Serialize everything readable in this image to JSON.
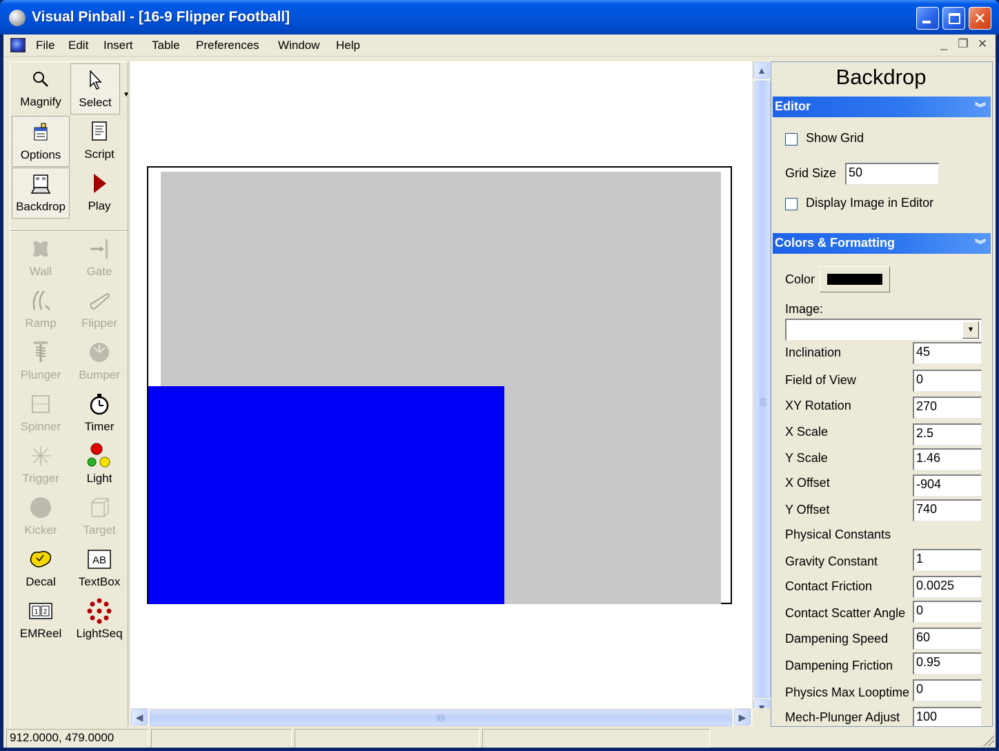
{
  "window": {
    "title": "Visual Pinball - [16-9 Flipper Football]"
  },
  "menubar": {
    "items": [
      "File",
      "Edit",
      "Insert",
      "Table",
      "Preferences",
      "Window",
      "Help"
    ],
    "mdi_min": "_",
    "mdi_restore": "❐",
    "mdi_close": "✕"
  },
  "toolbox": {
    "tools": [
      {
        "label": "Magnify",
        "icon": "magnify-icon",
        "enabled": true
      },
      {
        "label": "Select",
        "icon": "cursor-arrow-icon",
        "enabled": true,
        "pressed": true
      },
      {
        "label": "Options",
        "icon": "options-icon",
        "enabled": true,
        "pressed": true
      },
      {
        "label": "Script",
        "icon": "script-icon",
        "enabled": true
      },
      {
        "label": "Backdrop",
        "icon": "backdrop-icon",
        "enabled": true,
        "pressed": true
      },
      {
        "label": "Play",
        "icon": "play-icon",
        "enabled": true
      },
      {
        "label": "Wall",
        "icon": "wall-icon",
        "enabled": false
      },
      {
        "label": "Gate",
        "icon": "gate-icon",
        "enabled": false
      },
      {
        "label": "Ramp",
        "icon": "ramp-icon",
        "enabled": false
      },
      {
        "label": "Flipper",
        "icon": "flipper-icon",
        "enabled": false
      },
      {
        "label": "Plunger",
        "icon": "plunger-icon",
        "enabled": false
      },
      {
        "label": "Bumper",
        "icon": "bumper-icon",
        "enabled": false
      },
      {
        "label": "Spinner",
        "icon": "spinner-icon",
        "enabled": false
      },
      {
        "label": "Timer",
        "icon": "stopwatch-icon",
        "enabled": true
      },
      {
        "label": "Trigger",
        "icon": "trigger-icon",
        "enabled": false
      },
      {
        "label": "Light",
        "icon": "light-icon",
        "enabled": true
      },
      {
        "label": "Kicker",
        "icon": "kicker-icon",
        "enabled": false
      },
      {
        "label": "Target",
        "icon": "target-icon",
        "enabled": false
      },
      {
        "label": "Decal",
        "icon": "decal-icon",
        "enabled": true
      },
      {
        "label": "TextBox",
        "icon": "textbox-icon",
        "enabled": true
      },
      {
        "label": "EMReel",
        "icon": "emreel-icon",
        "enabled": true
      },
      {
        "label": "LightSeq",
        "icon": "lightseq-icon",
        "enabled": true
      }
    ]
  },
  "canvas": {
    "table_gray_color": "#c8c8c8",
    "table_blue_color": "#0000f6"
  },
  "properties": {
    "title": "Backdrop",
    "editor_header": "Editor",
    "show_grid_label": "Show Grid",
    "show_grid_checked": false,
    "grid_size_label": "Grid Size",
    "grid_size_value": "50",
    "display_image_label": "Display Image in Editor",
    "display_image_checked": false,
    "colors_header": "Colors & Formatting",
    "color_label": "Color",
    "color_value": "#000000",
    "image_label": "Image:",
    "image_value": "",
    "fields": [
      {
        "label": "Inclination",
        "value": "45"
      },
      {
        "label": "Field of View",
        "value": "0"
      },
      {
        "label": "XY Rotation",
        "value": "270"
      },
      {
        "label": "X Scale",
        "value": "2.5"
      },
      {
        "label": "Y Scale",
        "value": "1.46"
      },
      {
        "label": "X Offset",
        "value": "-904"
      },
      {
        "label": "Y Offset",
        "value": "740"
      }
    ],
    "physical_header": "Physical Constants",
    "physics": [
      {
        "label": "Gravity Constant",
        "value": "1"
      },
      {
        "label": "Contact Friction",
        "value": "0.0025"
      },
      {
        "label": "Contact Scatter Angle",
        "value": "0"
      },
      {
        "label": "Dampening Speed",
        "value": "60"
      },
      {
        "label": "Dampening Friction",
        "value": "0.95"
      },
      {
        "label": "Physics Max Looptime",
        "value": "0"
      },
      {
        "label": "Mech-Plunger Adjust",
        "value": "100"
      }
    ]
  },
  "statusbar": {
    "coords": "912.0000, 479.0000"
  }
}
